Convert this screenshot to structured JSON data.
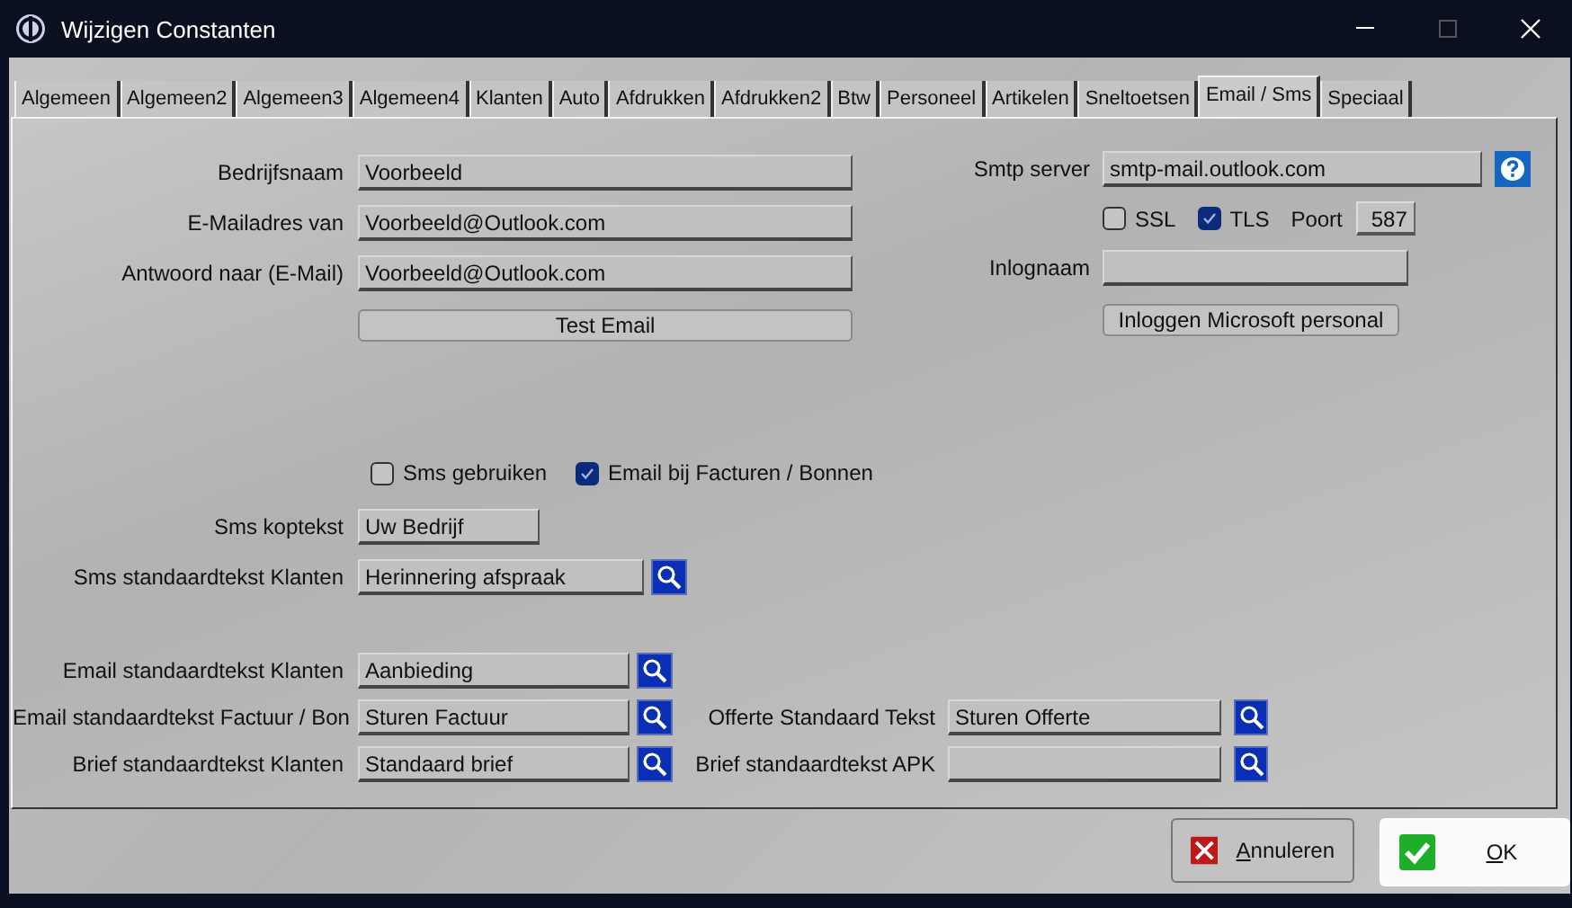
{
  "window": {
    "title": "Wijzigen Constanten"
  },
  "tabs": [
    {
      "label": "Algemeen",
      "selected": false
    },
    {
      "label": "Algemeen2",
      "selected": false
    },
    {
      "label": "Algemeen3",
      "selected": false
    },
    {
      "label": "Algemeen4",
      "selected": false
    },
    {
      "label": "Klanten",
      "selected": false
    },
    {
      "label": "Auto",
      "selected": false
    },
    {
      "label": "Afdrukken",
      "selected": false
    },
    {
      "label": "Afdrukken2",
      "selected": false
    },
    {
      "label": "Btw",
      "selected": false
    },
    {
      "label": "Personeel",
      "selected": false
    },
    {
      "label": "Artikelen",
      "selected": false
    },
    {
      "label": "Sneltoetsen",
      "selected": false
    },
    {
      "label": "Email / Sms",
      "selected": true
    },
    {
      "label": "Speciaal",
      "selected": false
    }
  ],
  "general": {
    "fields": [
      {
        "label": "Bedrijfsnaam",
        "value": "Voorbeeld"
      },
      {
        "label": "E-Mailadres van",
        "value": "Voorbeeld@Outlook.com"
      },
      {
        "label": "Antwoord naar (E-Mail)",
        "value": "Voorbeeld@Outlook.com"
      }
    ],
    "test_button": "Test Email"
  },
  "smtp": {
    "label": "Smtp server",
    "value": "smtp-mail.outlook.com",
    "options": [
      {
        "label": "SSL",
        "checked": false
      },
      {
        "label": "TLS",
        "checked": true
      }
    ],
    "port_label": "Poort",
    "port": "587",
    "login_label": "Inlognaam",
    "login_button": "Inloggen Microsoft personal"
  },
  "sms_options": [
    {
      "label": "Sms gebruiken",
      "checked": false
    },
    {
      "label": "Email bij Facturen / Bonnen",
      "checked": true
    }
  ],
  "sms": [
    {
      "label": "Sms koptekst",
      "value": "Uw Bedrijf",
      "kind": "short"
    },
    {
      "label": "Sms standaardtekst Klanten",
      "value": "Herinnering afspraak",
      "kind": "lookup"
    }
  ],
  "templates": [
    {
      "label": "Email standaardtekst Klanten",
      "value": "Aanbieding"
    },
    {
      "label": "Email standaardtekst Factuur / Bon",
      "value": "Sturen Factuur"
    },
    {
      "label": "Brief standaardtekst Klanten",
      "value": "Standaard brief"
    }
  ],
  "templates_right": [
    {
      "label": "Offerte Standaard Tekst",
      "value": "Sturen Offerte"
    },
    {
      "label": "Brief standaardtekst APK"
    }
  ],
  "buttons": [
    {
      "label": "Annuleren",
      "kind": "cancel",
      "focused": false
    },
    {
      "label": "OK",
      "kind": "ok",
      "focused": true
    }
  ]
}
